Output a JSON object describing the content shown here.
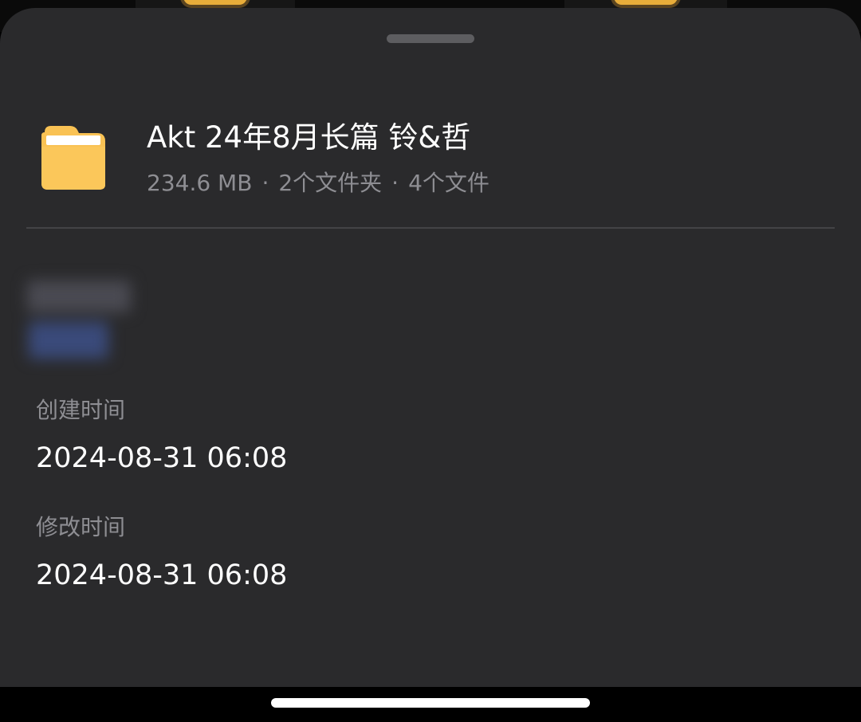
{
  "folder": {
    "name": "Akt 24年8月长篇 铃&哲",
    "size": "234.6 MB",
    "folders": "2个文件夹",
    "files": "4个文件",
    "separator": "·",
    "icon": "folder-icon",
    "icon_color": "#f9c254"
  },
  "details": {
    "created_label": "创建时间",
    "created_value": "2024-08-31 06:08",
    "modified_label": "修改时间",
    "modified_value": "2024-08-31 06:08"
  },
  "colors": {
    "sheet_background": "#2a2a2c",
    "primary_text": "#ffffff",
    "secondary_text": "#8e8e93"
  }
}
